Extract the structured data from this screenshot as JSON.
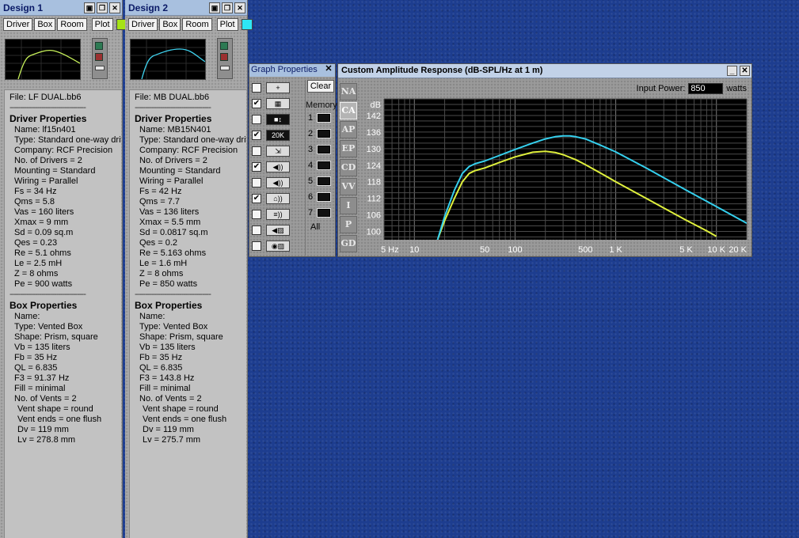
{
  "designs": [
    {
      "title": "Design 1",
      "buttons": [
        "Driver",
        "Box",
        "Room",
        "Plot"
      ],
      "swatch_color": "#a6e317",
      "curve_color": "#c8f25a",
      "file": "File: LF DUAL.bb6",
      "separator": "------------------------------------",
      "driver_heading": "Driver Properties",
      "driver_lines": [
        "Name: lf15n401",
        "Type: Standard one-way drive",
        "Company: RCF Precision",
        "No. of Drivers = 2",
        "Mounting = Standard",
        "Wiring = Parallel",
        "Fs = 34 Hz",
        "Qms = 5.8",
        "Vas = 160 liters",
        "Xmax = 9 mm",
        "Sd = 0.09 sq.m",
        "Qes = 0.23",
        "Re = 5.1 ohms",
        "Le = 2.5 mH",
        "Z = 8 ohms",
        "Pe = 900 watts"
      ],
      "box_heading": "Box Properties",
      "box_lines": [
        "Name:",
        "Type: Vented Box",
        "Shape: Prism, square",
        "Vb = 135 liters",
        "Fb = 35 Hz",
        "QL = 6.835",
        "F3 = 91.37 Hz",
        "Fill = minimal",
        "No. of Vents = 2"
      ],
      "vent_lines": [
        "Vent shape = round",
        "Vent ends = one flush",
        "Dv = 119 mm",
        "Lv = 278.8 mm"
      ]
    },
    {
      "title": "Design 2",
      "buttons": [
        "Driver",
        "Box",
        "Room",
        "Plot"
      ],
      "swatch_color": "#2ee6f5",
      "curve_color": "#3fd2ee",
      "file": "File: MB DUAL.bb6",
      "separator": "------------------------------------",
      "driver_heading": "Driver Properties",
      "driver_lines": [
        "Name: MB15N401",
        "Type: Standard one-way drive",
        "Company: RCF Precision",
        "No. of Drivers = 2",
        "Mounting = Standard",
        "Wiring = Parallel",
        "Fs = 42 Hz",
        "Qms = 7.7",
        "Vas = 136 liters",
        "Xmax = 5.5 mm",
        "Sd = 0.0817 sq.m",
        "Qes = 0.2",
        "Re = 5.163 ohms",
        "Le = 1.6 mH",
        "Z = 8 ohms",
        "Pe = 850 watts"
      ],
      "box_heading": "Box Properties",
      "box_lines": [
        "Name:",
        "Type: Vented Box",
        "Shape: Prism, square",
        "Vb = 135 liters",
        "Fb = 35 Hz",
        "QL = 6.835",
        "F3 = 143.8 Hz",
        "Fill = minimal",
        "No. of Vents = 2"
      ],
      "vent_lines": [
        "Vent shape = round",
        "Vent ends = one flush",
        "Dv = 119 mm",
        "Lv = 275.7 mm"
      ]
    }
  ],
  "graph_properties": {
    "title": "Graph Properties",
    "clear_label": "Clear",
    "memory_label": "Memory",
    "memory_slots": [
      "1",
      "2",
      "3",
      "4",
      "5",
      "6",
      "7"
    ],
    "all_label": "All",
    "options": [
      {
        "checked": false,
        "icon": "crosshair-icon",
        "glyph": "+"
      },
      {
        "checked": true,
        "icon": "grid-icon",
        "glyph": "▦"
      },
      {
        "checked": false,
        "icon": "vertical-scale-icon",
        "glyph": "■↕"
      },
      {
        "checked": true,
        "icon": "frequency-range-icon",
        "glyph": "20K"
      },
      {
        "checked": false,
        "icon": "resize-icon",
        "glyph": "⇲"
      },
      {
        "checked": true,
        "icon": "speaker-sound-icon",
        "glyph": "◀))"
      },
      {
        "checked": false,
        "icon": "speaker-sound-icon",
        "glyph": "◀))"
      },
      {
        "checked": true,
        "icon": "room-sound-icon",
        "glyph": "⌂))"
      },
      {
        "checked": false,
        "icon": "mic-sound-icon",
        "glyph": "≡))"
      },
      {
        "checked": false,
        "icon": "speaker-chart-icon",
        "glyph": "◀▨"
      },
      {
        "checked": false,
        "icon": "driver-chart-icon",
        "glyph": "◉▨"
      }
    ]
  },
  "amplitude": {
    "title": "Custom Amplitude Response (dB-SPL/Hz at 1 m)",
    "input_power_label": "Input Power:",
    "input_power_value": "850",
    "input_power_unit": "watts",
    "side_tabs": [
      "NA",
      "CA",
      "AP",
      "EP",
      "CD",
      "VV",
      "I",
      "P",
      "GD"
    ],
    "active_tab": "CA",
    "chart_data": {
      "type": "line",
      "title": "Custom Amplitude Response (dB-SPL/Hz at 1 m)",
      "ylabel": "dB",
      "xscale": "log",
      "xlim": [
        5,
        20000
      ],
      "ylim": [
        97,
        148
      ],
      "grid": true,
      "y_ticks": [
        100,
        106,
        112,
        118,
        124,
        130,
        136,
        142
      ],
      "x_ticks": [
        {
          "value": 5,
          "label": "5 Hz"
        },
        {
          "value": 10,
          "label": "10"
        },
        {
          "value": 50,
          "label": "50"
        },
        {
          "value": 100,
          "label": "100"
        },
        {
          "value": 500,
          "label": "500"
        },
        {
          "value": 1000,
          "label": "1 K"
        },
        {
          "value": 5000,
          "label": "5 K"
        },
        {
          "value": 10000,
          "label": "10 K"
        },
        {
          "value": 20000,
          "label": "20 K"
        }
      ],
      "series": [
        {
          "color": "#dff03c",
          "x": [
            17,
            20,
            25,
            30,
            35,
            40,
            50,
            70,
            100,
            150,
            200,
            250,
            300,
            400,
            500,
            700,
            1000,
            2000,
            3000,
            5000,
            8000,
            10000
          ],
          "y": [
            97,
            104,
            112,
            118,
            121,
            122,
            123,
            125,
            127,
            128.7,
            129,
            128.6,
            127.8,
            126,
            124.2,
            121.2,
            118,
            112,
            108.5,
            104.1,
            100.2,
            98.2
          ]
        },
        {
          "color": "#35d0ee",
          "x": [
            17,
            20,
            25,
            30,
            35,
            40,
            50,
            70,
            100,
            150,
            200,
            250,
            300,
            350,
            400,
            500,
            700,
            1000,
            2000,
            5000,
            10000,
            20000
          ],
          "y": [
            97,
            105.5,
            115,
            121,
            123.5,
            124.5,
            125.5,
            127.5,
            129.7,
            132,
            133.5,
            134.3,
            134.6,
            134.6,
            134.3,
            133.5,
            131.3,
            128.8,
            123,
            115,
            109,
            103
          ]
        }
      ]
    }
  }
}
